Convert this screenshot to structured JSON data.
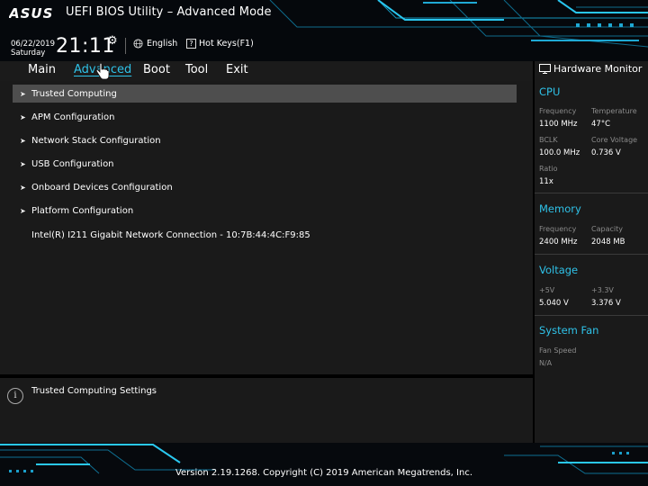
{
  "header": {
    "logo_text": "ASUS",
    "title": "UEFI BIOS Utility – Advanced Mode",
    "date": "06/22/2019",
    "day": "Saturday",
    "time": "21:11",
    "settings_icon": "gear-icon",
    "language_icon": "globe-icon",
    "language": "English",
    "hotkeys_icon": "question-icon",
    "hotkeys": "Hot Keys(F1)"
  },
  "menu": {
    "tabs": [
      {
        "label": "Main",
        "active": false
      },
      {
        "label": "Advanced",
        "active": true
      },
      {
        "label": "Boot",
        "active": false
      },
      {
        "label": "Tool",
        "active": false
      },
      {
        "label": "Exit",
        "active": false
      }
    ]
  },
  "main": {
    "items": [
      {
        "label": "Trusted Computing",
        "selected": true
      },
      {
        "label": "APM Configuration",
        "selected": false
      },
      {
        "label": "Network Stack Configuration",
        "selected": false
      },
      {
        "label": "USB Configuration",
        "selected": false
      },
      {
        "label": "Onboard Devices Configuration",
        "selected": false
      },
      {
        "label": "Platform Configuration",
        "selected": false
      }
    ],
    "info_line": "Intel(R) I211 Gigabit  Network Connection - 10:7B:44:4C:F9:85"
  },
  "help": {
    "icon": "info-icon",
    "text": "Trusted Computing Settings"
  },
  "hardware_monitor": {
    "icon": "monitor-icon",
    "title": "Hardware Monitor",
    "cpu": {
      "heading": "CPU",
      "frequency_label": "Frequency",
      "frequency": "1100 MHz",
      "temperature_label": "Temperature",
      "temperature": "47°C",
      "bclk_label": "BCLK",
      "bclk": "100.0 MHz",
      "core_voltage_label": "Core Voltage",
      "core_voltage": "0.736 V",
      "ratio_label": "Ratio",
      "ratio": "11x"
    },
    "memory": {
      "heading": "Memory",
      "frequency_label": "Frequency",
      "frequency": "2400 MHz",
      "capacity_label": "Capacity",
      "capacity": "2048 MB"
    },
    "voltage": {
      "heading": "Voltage",
      "v5_label": "+5V",
      "v5": "5.040 V",
      "v33_label": "+3.3V",
      "v33": "3.376 V"
    },
    "fan": {
      "heading": "System Fan",
      "speed_label": "Fan Speed",
      "speed": "N/A"
    }
  },
  "footer": {
    "version": "Version 2.19.1268. Copyright (C) 2019 American Megatrends, Inc."
  },
  "colors": {
    "accent": "#2fc2e8",
    "panel": "#1a1a1a",
    "selected": "#4e4e4e"
  }
}
